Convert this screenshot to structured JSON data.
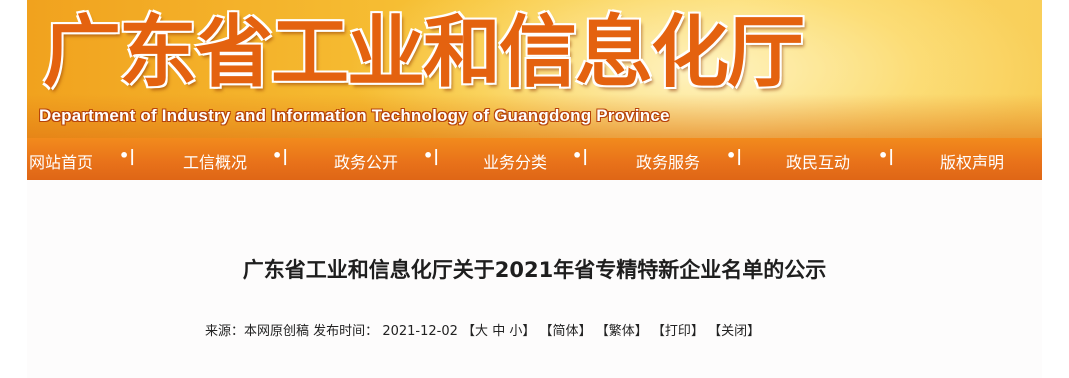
{
  "banner": {
    "title": "广东省工业和信息化厅",
    "subtitle": "Department of Industry and Information Technology of Guangdong Province"
  },
  "nav": {
    "items": [
      {
        "label": "网站首页"
      },
      {
        "label": "工信概况"
      },
      {
        "label": "政务公开"
      },
      {
        "label": "业务分类"
      },
      {
        "label": "政务服务"
      },
      {
        "label": "政民互动"
      },
      {
        "label": "版权声明"
      }
    ],
    "separator": "•|"
  },
  "article": {
    "title": "广东省工业和信息化厅关于2021年省专精特新企业名单的公示",
    "source_label": "来源：",
    "source_value": "本网原创稿",
    "time_label": "发布时间：",
    "time_value": "2021-12-02",
    "size_large": "大",
    "size_medium": "中",
    "size_small": "小",
    "simplified": "简体",
    "traditional": "繁体",
    "print": "打印",
    "close": "关闭"
  },
  "colors": {
    "nav_bg": "#e9731a",
    "banner_title": "#e4620f"
  }
}
